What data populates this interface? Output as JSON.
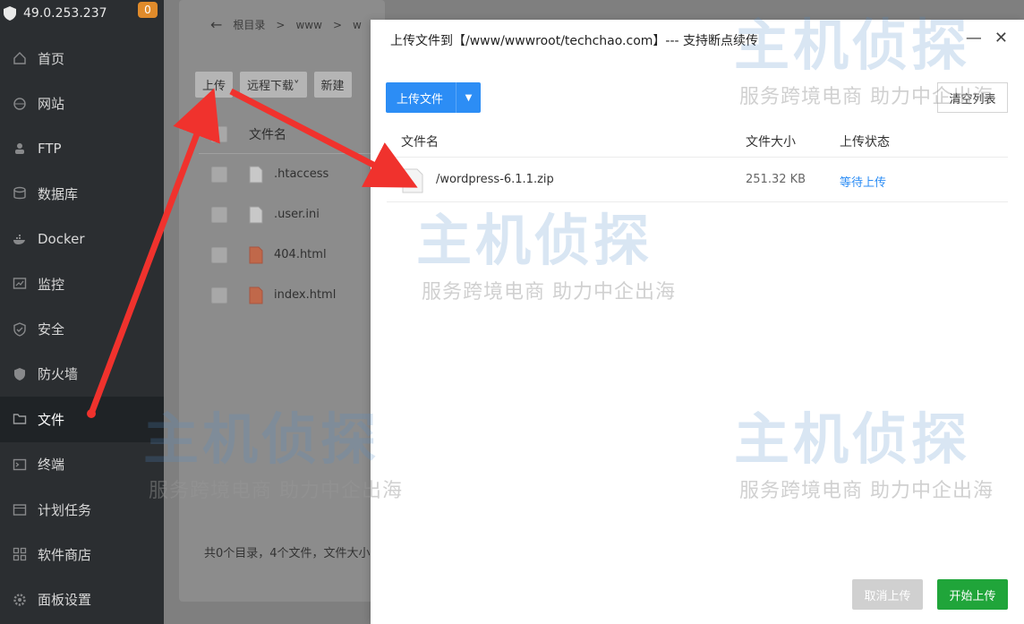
{
  "sidebar": {
    "ip": "49.0.253.237",
    "badge": "0",
    "items": [
      {
        "label": "首页",
        "icon": "home-icon"
      },
      {
        "label": "网站",
        "icon": "globe-icon"
      },
      {
        "label": "FTP",
        "icon": "ftp-icon"
      },
      {
        "label": "数据库",
        "icon": "database-icon"
      },
      {
        "label": "Docker",
        "icon": "docker-icon"
      },
      {
        "label": "监控",
        "icon": "monitor-icon"
      },
      {
        "label": "安全",
        "icon": "security-icon"
      },
      {
        "label": "防火墙",
        "icon": "firewall-icon"
      },
      {
        "label": "文件",
        "icon": "folder-icon"
      },
      {
        "label": "终端",
        "icon": "terminal-icon"
      },
      {
        "label": "计划任务",
        "icon": "calendar-icon"
      },
      {
        "label": "软件商店",
        "icon": "apps-icon"
      },
      {
        "label": "面板设置",
        "icon": "settings-icon"
      }
    ],
    "active_index": 8
  },
  "filemanager": {
    "crumbs": [
      "根目录",
      ">",
      "www",
      ">",
      "w"
    ],
    "toolbar": [
      "上传",
      "远程下载",
      "新建"
    ],
    "col_name": "文件名",
    "files": [
      ".htaccess",
      ".user.ini",
      "404.html",
      "index.html"
    ],
    "footer": "共0个目录，4个文件，文件大小"
  },
  "modal": {
    "title": "上传文件到【/www/wwwroot/techchao.com】--- 支持断点续传",
    "upload_label": "上传文件",
    "clear_label": "清空列表",
    "headers": {
      "name": "文件名",
      "size": "文件大小",
      "status": "上传状态"
    },
    "rows": [
      {
        "name": "/wordpress-6.1.1.zip",
        "size": "251.32 KB",
        "status": "等待上传"
      }
    ],
    "cancel_label": "取消上传",
    "start_label": "开始上传"
  },
  "watermark": {
    "brand": "主机侦探",
    "slogan": "服务跨境电商 助力中企出海"
  },
  "colors": {
    "primary": "#2c8df5",
    "success": "#20a53a",
    "sidebar": "#2b2e31",
    "badge": "#e08b2b",
    "arrow": "#f0322d"
  }
}
